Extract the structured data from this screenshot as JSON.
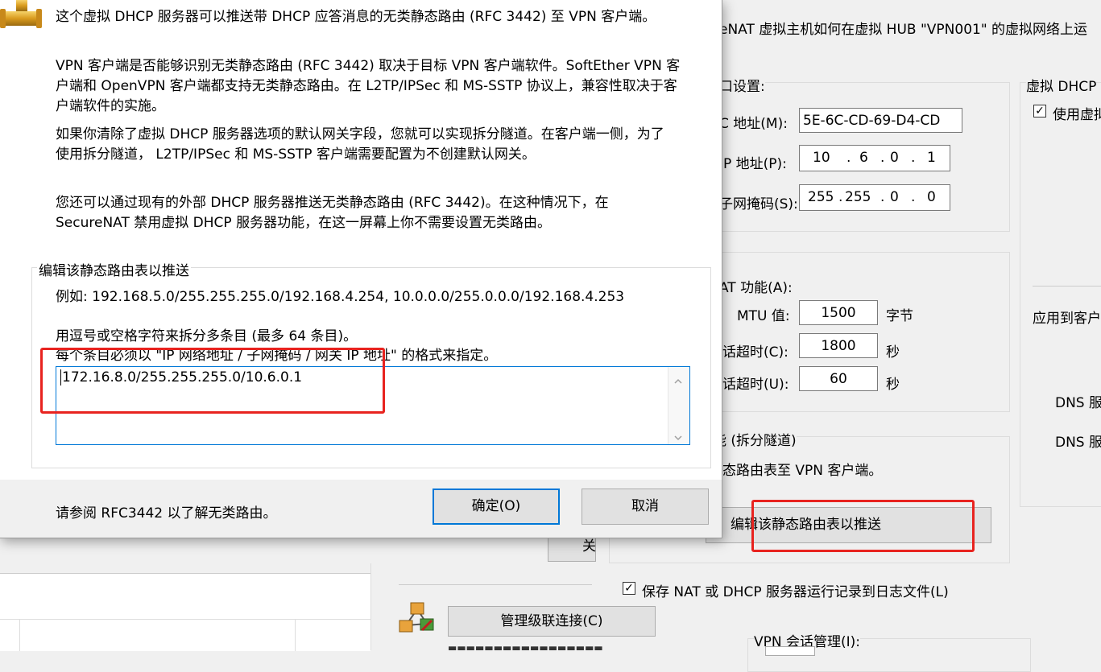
{
  "bg_window": {
    "top_line": "eNAT 虚拟主机如何在虚拟 HUB \"VPN001\" 的虚拟网络上运",
    "interface_group": {
      "title": "口设置:",
      "mac_label": "C 地址(M):",
      "mac_value": "5E-6C-CD-69-D4-CD",
      "ip_label": "IP 地址(P):",
      "ip_octets": [
        "10",
        "6",
        "0",
        "1"
      ],
      "mask_label": "子网掩码(S):",
      "mask_octets": [
        "255",
        "255",
        "0",
        "0"
      ]
    },
    "nat_group": {
      "title": "AT 功能(A):",
      "mtu_label": "MTU 值:",
      "mtu_value": "1500",
      "mtu_unit": "字节",
      "tcp_label": "话超时(C):",
      "tcp_value": "1800",
      "tcp_unit": "秒",
      "udp_label": "话超时(U):",
      "udp_value": "60",
      "udp_unit": "秒"
    },
    "split_group": {
      "title": "能 (拆分隧道)",
      "desc": "态路由表至 VPN 客户端。",
      "edit_button": "编辑该静态路由表以推送"
    },
    "dhcp_group": {
      "title": "虚拟 DHCP",
      "use_checkbox": "使用虚拟",
      "apply_label": "应用到客户",
      "dns1": "DNS 服",
      "dns2": "DNS 服"
    },
    "log_checkbox": "保存 NAT 或 DHCP 服务器运行记录到日志文件(L)",
    "close_btn_fragment": "关",
    "cascade_button": "管理级联连接(C)",
    "vpn_session_group": "VPN 会话管理(I):"
  },
  "dialog": {
    "para1": "这个虚拟 DHCP 服务器可以推送带 DHCP 应答消息的无类静态路由 (RFC 3442) 至 VPN 客户端。",
    "para2": [
      "VPN 客户端是否能够识别无类静态路由 (RFC 3442) 取决于目标 VPN 客户端软件。SoftEther VPN 客",
      "户端和 OpenVPN 客户端都支持无类静态路由。在 L2TP/IPSec 和 MS-SSTP 协议上，兼容性取决于客",
      "户端软件的实施。"
    ],
    "para3": [
      "如果你清除了虚拟 DHCP 服务器选项的默认网关字段，您就可以实现拆分隧道。在客户端一侧，为了",
      "使用拆分隧道， L2TP/IPSec 和 MS-SSTP 客户端需要配置为不创建默认网关。"
    ],
    "para4": [
      "您还可以通过现有的外部 DHCP 服务器推送无类静态路由 (RFC 3442)。在这种情况下，在",
      "SecureNAT 禁用虚拟 DHCP 服务器功能，在这一屏幕上你不需要设置无类路由。"
    ],
    "group_title": "编辑该静态路由表以推送",
    "example": "例如: 192.168.5.0/255.255.255.0/192.168.4.254, 10.0.0.0/255.0.0.0/192.168.4.253",
    "hint1": "用逗号或空格字符来拆分多条目 (最多 64 条目)。",
    "hint2": "每个条目必须以 \"IP 网络地址 / 子网掩码 / 网关 IP 地址\" 的格式来指定。",
    "routes_value": "172.16.8.0/255.255.255.0/10.6.0.1",
    "footer_note": "请参阅 RFC3442 以了解无类路由。",
    "ok_button": "确定(O)",
    "cancel_button": "取消"
  },
  "colors": {
    "highlight_red": "#e8231f",
    "focus_blue": "#0078d7"
  }
}
